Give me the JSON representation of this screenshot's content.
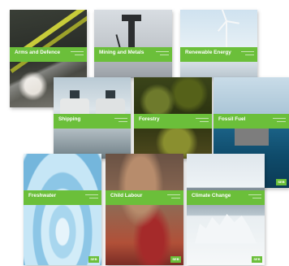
{
  "covers": [
    {
      "title": "Arms and Defence"
    },
    {
      "title": "Mining and Metals"
    },
    {
      "title": "Renewable Energy"
    },
    {
      "title": "Shipping"
    },
    {
      "title": "Forestry"
    },
    {
      "title": "Fossil Fuel",
      "logo": "SEB"
    },
    {
      "title": "Freshwater",
      "logo": "SEB"
    },
    {
      "title": "Child Labour",
      "logo": "SEB"
    },
    {
      "title": "Climate Change",
      "logo": "SEB"
    }
  ],
  "colors": {
    "band": "#6bbf3a",
    "background": "#ffffff"
  }
}
